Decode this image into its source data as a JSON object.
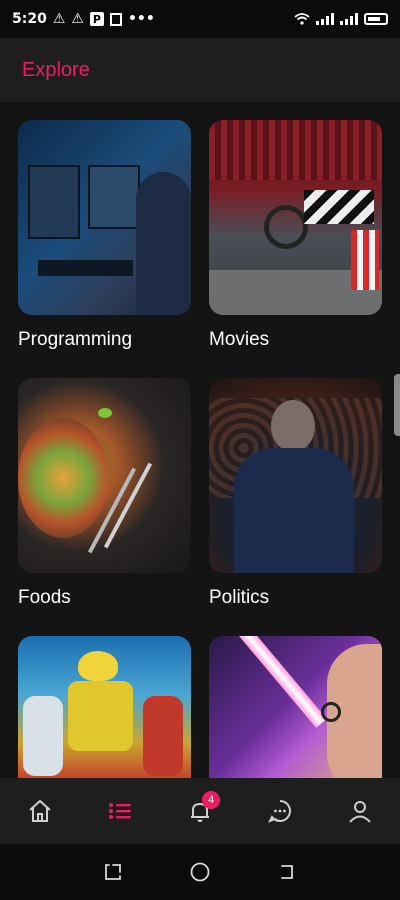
{
  "status_bar": {
    "time": "5:20",
    "icons": [
      "warning-icon",
      "warning-icon",
      "parking-icon",
      "document-icon",
      "more-dots-icon",
      "wifi-icon",
      "signal-icon",
      "signal-icon",
      "battery-charging-icon"
    ]
  },
  "header": {
    "title": "Explore",
    "accent_color": "#e91e63"
  },
  "categories": [
    {
      "label": "Programming"
    },
    {
      "label": "Movies"
    },
    {
      "label": "Foods"
    },
    {
      "label": "Politics"
    },
    {
      "label": ""
    },
    {
      "label": ""
    }
  ],
  "bottom_nav": {
    "items": [
      {
        "icon": "home-icon",
        "active": false
      },
      {
        "icon": "list-icon",
        "active": true
      },
      {
        "icon": "bell-icon",
        "active": false,
        "badge": "4"
      },
      {
        "icon": "chat-icon",
        "active": false
      },
      {
        "icon": "profile-icon",
        "active": false
      }
    ],
    "active_color": "#e91e63",
    "inactive_color": "#cfcfcf"
  },
  "system_nav": {
    "items": [
      "recent-apps-icon",
      "home-circle-icon",
      "back-icon"
    ]
  }
}
